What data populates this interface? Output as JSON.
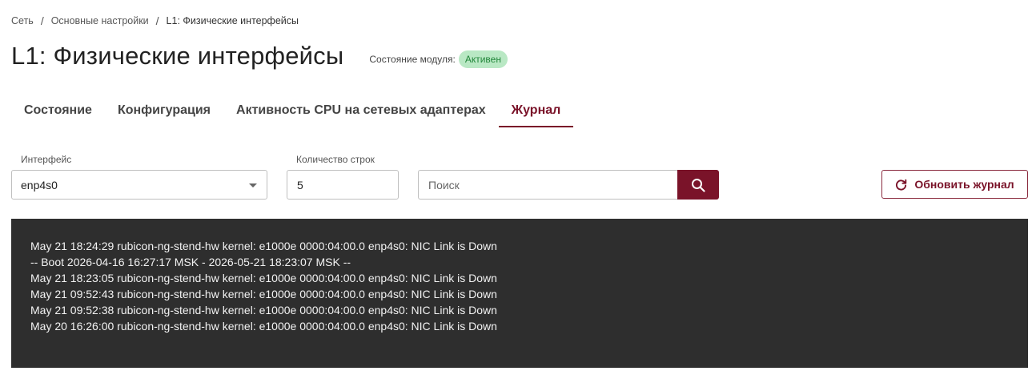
{
  "breadcrumb": {
    "items": [
      "Сеть",
      "Основные настройки",
      "L1: Физические интерфейсы"
    ],
    "separator": "/"
  },
  "header": {
    "title": "L1: Физические интерфейсы",
    "module_state_label": "Состояние модуля:",
    "module_state_value": "Активен"
  },
  "tabs": [
    {
      "label": "Состояние",
      "active": false
    },
    {
      "label": "Конфигурация",
      "active": false
    },
    {
      "label": "Активность CPU на сетевых адаптерах",
      "active": false
    },
    {
      "label": "Журнал",
      "active": true
    }
  ],
  "filters": {
    "interface_label": "Интерфейс",
    "interface_value": "enp4s0",
    "lines_label": "Количество строк",
    "lines_value": "5",
    "search_placeholder": "Поиск",
    "refresh_label": "Обновить журнал"
  },
  "log": {
    "lines": [
      "May 21 18:24:29 rubicon-ng-stend-hw kernel: e1000e 0000:04:00.0 enp4s0: NIC Link is Down",
      "-- Boot 2026-04-16 16:27:17 MSK - 2026-05-21 18:23:07 MSK --",
      "May 21 18:23:05 rubicon-ng-stend-hw kernel: e1000e 0000:04:00.0 enp4s0: NIC Link is Down",
      "May 21 09:52:43 rubicon-ng-stend-hw kernel: e1000e 0000:04:00.0 enp4s0: NIC Link is Down",
      "May 21 09:52:38 rubicon-ng-stend-hw kernel: e1000e 0000:04:00.0 enp4s0: NIC Link is Down",
      "May 20 16:26:00 rubicon-ng-stend-hw kernel: e1000e 0000:04:00.0 enp4s0: NIC Link is Down"
    ]
  },
  "colors": {
    "accent": "#7a1329",
    "badge_bg": "#b9e8c4",
    "badge_text": "#22863a",
    "log_bg": "#2e2e2e"
  },
  "icons": {
    "search": "search-icon",
    "refresh": "refresh-icon",
    "dropdown": "chevron-down-icon"
  }
}
